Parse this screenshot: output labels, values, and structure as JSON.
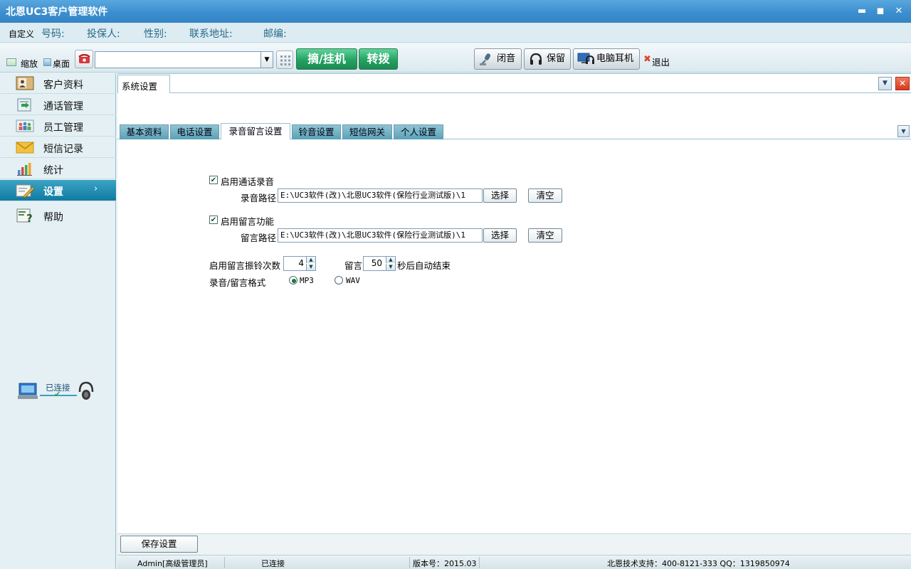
{
  "window": {
    "title": "北恩UC3客户管理软件",
    "minimize_glyph": "▬",
    "maximize_glyph": "◼",
    "close_glyph": "✕"
  },
  "infobar": {
    "customize_label": "自定义",
    "number_label": "号码:",
    "insured_label": "投保人:",
    "gender_label": "性别:",
    "address_label": "联系地址:",
    "postcode_label": "邮编:"
  },
  "toolbar": {
    "shrink_label": "缩放",
    "desktop_label": "桌面",
    "dial_value": "",
    "pickup_hangup_label": "摘/挂机",
    "transfer_label": "转拨",
    "mute_label": "闭音",
    "hold_label": "保留",
    "pc_headset_label": "电脑耳机",
    "exit_label": "退出"
  },
  "sidebar": {
    "items": [
      {
        "label": "客户资料",
        "icon": "customer-profile-icon"
      },
      {
        "label": "通话管理",
        "icon": "call-management-icon"
      },
      {
        "label": "员工管理",
        "icon": "staff-management-icon"
      },
      {
        "label": "短信记录",
        "icon": "sms-envelope-icon"
      },
      {
        "label": "统计",
        "icon": "bar-chart-icon"
      },
      {
        "label": "设置",
        "icon": "settings-pencil-icon",
        "active": true
      },
      {
        "label": "帮助",
        "icon": "help-icon"
      }
    ],
    "active_arrow": "›",
    "connection_status": "已连接"
  },
  "content": {
    "doc_tab": "系统设置",
    "sub_tabs": [
      {
        "label": "基本资料"
      },
      {
        "label": "电话设置"
      },
      {
        "label": "录音留言设置",
        "active": true
      },
      {
        "label": "铃音设置"
      },
      {
        "label": "短信网关"
      },
      {
        "label": "个人设置"
      }
    ],
    "form": {
      "enable_recording_label": "启用通话录音",
      "enable_recording_checked": true,
      "recording_path_label": "录音路径",
      "recording_path_value": "E:\\UC3软件(改)\\北恩UC3软件(保险行业测试版)\\1",
      "select_label": "选择",
      "clear_label": "清空",
      "enable_voicemail_label": "启用留言功能",
      "enable_voicemail_checked": true,
      "voicemail_path_label": "留言路径",
      "voicemail_path_value": "E:\\UC3软件(改)\\北恩UC3软件(保险行业测试版)\\1",
      "ring_count_label": "启用留言振铃次数",
      "ring_count_value": "4",
      "message_label": "留言",
      "message_seconds_value": "50",
      "auto_end_label": "秒后自动结束",
      "format_label": "录音/留言格式",
      "format_options": [
        "MP3",
        "WAV"
      ],
      "format_selected": "MP3"
    },
    "save_label": "保存设置"
  },
  "statusbar": {
    "user": "Admin[高级管理员]",
    "connection": "已连接",
    "version": "版本号：2015.03",
    "support": "北恩技术支持：400-8121-333 QQ：1319850974"
  },
  "colors": {
    "title_bar": "#3b8fd0",
    "active_nav": "#0f7ba1",
    "green_button": "#23a262",
    "close_red": "#e0452c"
  }
}
